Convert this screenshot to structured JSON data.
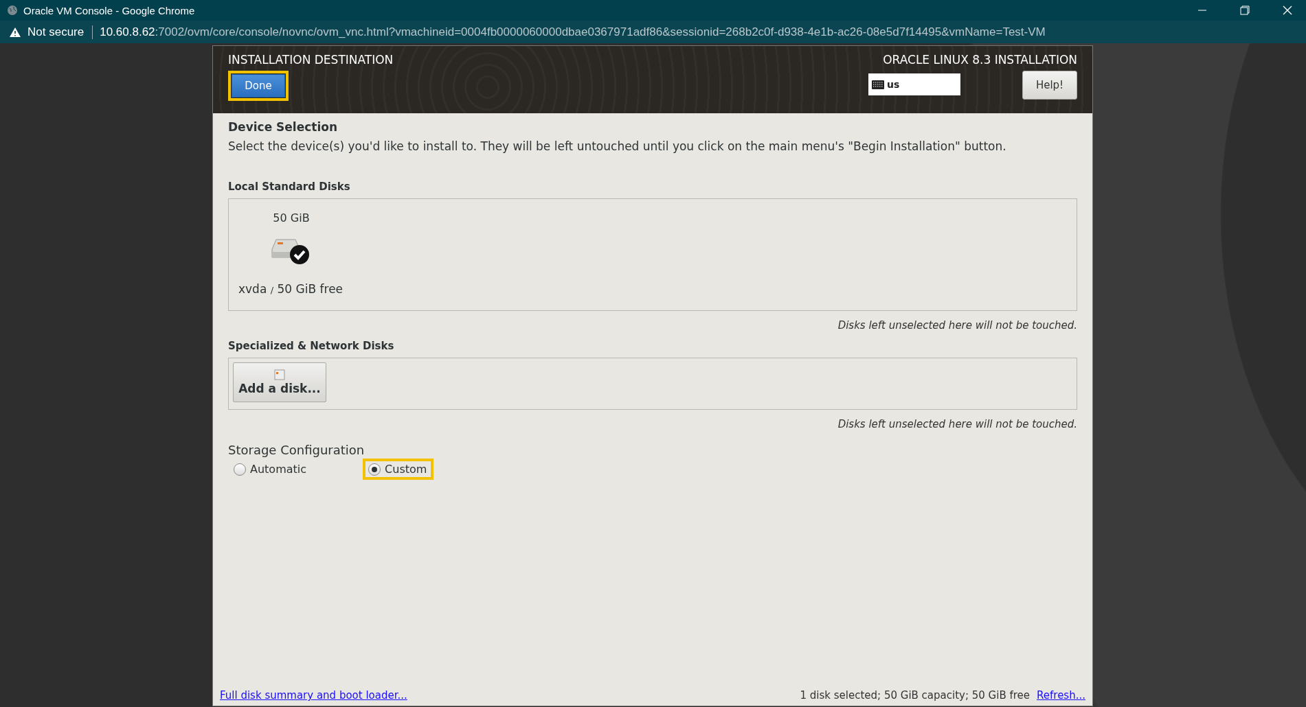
{
  "browser": {
    "title": "Oracle VM Console - Google Chrome",
    "security": "Not secure",
    "url": {
      "host": "10.60.8.62",
      "path": ":7002/ovm/core/console/novnc/ovm_vnc.html?vmachineid=0004fb0000060000dbae0367971adf86&sessionid=268b2c0f-d938-4e1b-ac26-08e5d7f14495&vmName=Test-VM"
    }
  },
  "installer": {
    "title": "INSTALLATION DESTINATION",
    "product": "ORACLE LINUX 8.3 INSTALLATION",
    "done": {
      "label": "Done",
      "highlighted": true
    },
    "keyboard": "us",
    "help": "Help!"
  },
  "device_selection": {
    "heading": "Device Selection",
    "description": "Select the device(s) you'd like to install to.  They will be left untouched until you click on the main menu's \"Begin Installation\" button."
  },
  "local_disks": {
    "heading": "Local Standard Disks",
    "disks": [
      {
        "size": "50 GiB",
        "name": "xvda",
        "separator": "/",
        "free": "50 GiB free",
        "selected": true
      }
    ],
    "note": "Disks left unselected here will not be touched."
  },
  "network_disks": {
    "heading": "Specialized & Network Disks",
    "add_button": "Add a disk...",
    "note": "Disks left unselected here will not be touched."
  },
  "storage": {
    "heading": "Storage Configuration",
    "options": [
      {
        "label": "Automatic",
        "selected": false,
        "highlighted": false
      },
      {
        "label": "Custom",
        "selected": true,
        "highlighted": true
      }
    ]
  },
  "footer": {
    "summary_link": "Full disk summary and boot loader...",
    "status": "1 disk selected; 50 GiB capacity; 50 GiB free",
    "refresh_link": "Refresh..."
  }
}
